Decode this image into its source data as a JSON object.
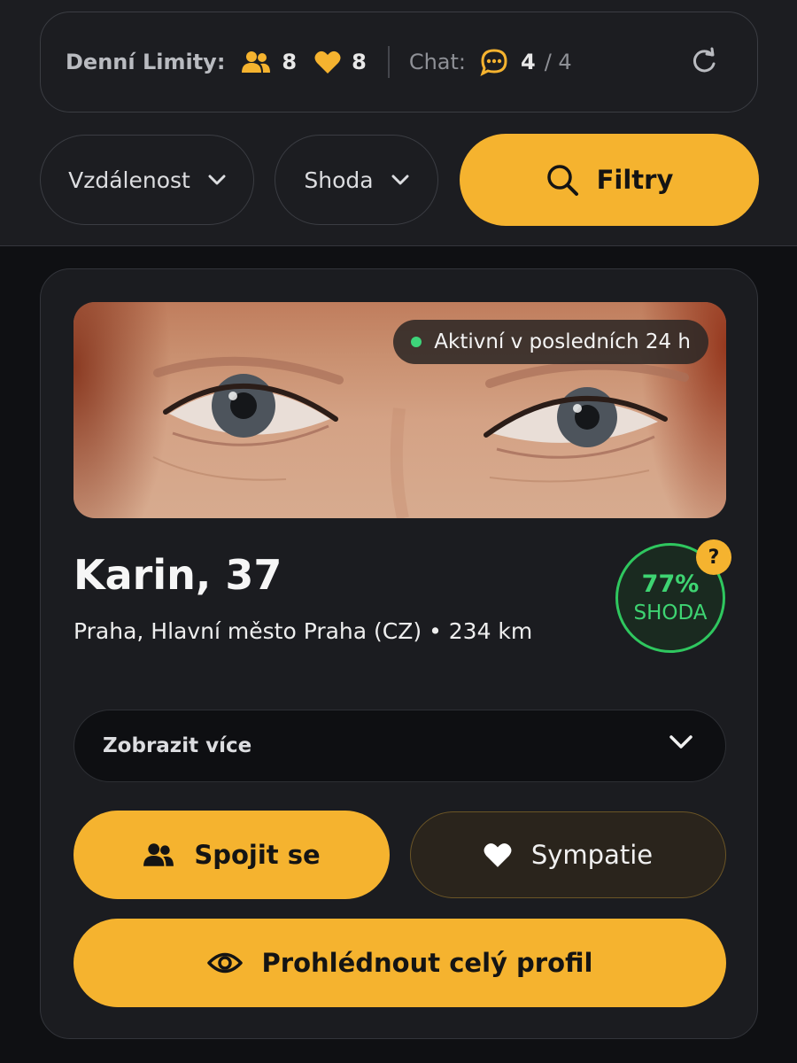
{
  "limits": {
    "label": "Denní Limity:",
    "connections": "8",
    "likes": "8",
    "chat_label": "Chat:",
    "chat_used": "4",
    "chat_total": "/ 4",
    "icons": [
      "users-icon",
      "heart-icon",
      "chat-icon",
      "refresh-icon"
    ]
  },
  "filters": {
    "distance_label": "Vzdálenost",
    "match_label": "Shoda",
    "filters_button": "Filtry"
  },
  "profile": {
    "active_status": "Aktivní v posledních 24 h",
    "name_age": "Karin, 37",
    "location": "Praha, Hlavní město Praha (CZ) • 234 km",
    "match_percent": "77%",
    "match_label": "SHODA",
    "help": "?",
    "show_more": "Zobrazit více"
  },
  "actions": {
    "connect": "Spojit se",
    "like": "Sympatie",
    "view_profile": "Prohlédnout celý profil"
  },
  "colors": {
    "accent": "#f5b32f",
    "match_green": "#3ed472",
    "background": "#0f1013",
    "card": "#1b1c20"
  }
}
